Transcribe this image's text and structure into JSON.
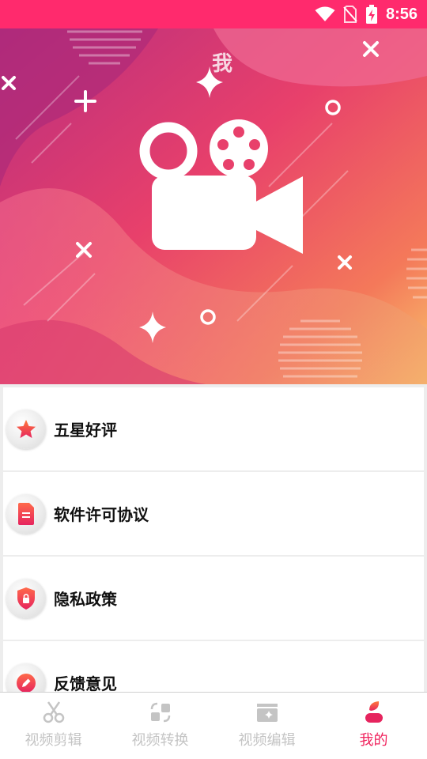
{
  "status": {
    "time": "8:56"
  },
  "banner": {
    "title": "我",
    "gradient": [
      "#b92e7e",
      "#e8406b",
      "#f4795a",
      "#f9c46d"
    ]
  },
  "menu": {
    "items": [
      {
        "label": "五星好评",
        "icon": "star-icon"
      },
      {
        "label": "软件许可协议",
        "icon": "document-icon"
      },
      {
        "label": "隐私政策",
        "icon": "shield-lock-icon"
      },
      {
        "label": "反馈意见",
        "icon": "pencil-icon"
      }
    ]
  },
  "tabs": [
    {
      "label": "视频剪辑",
      "icon": "scissors-icon",
      "active": false
    },
    {
      "label": "视频转换",
      "icon": "convert-icon",
      "active": false
    },
    {
      "label": "视频编辑",
      "icon": "clapperboard-icon",
      "active": false
    },
    {
      "label": "我的",
      "icon": "user-icon",
      "active": true
    }
  ],
  "colors": {
    "status_bar": "#ff2a6d",
    "accent": "#f0245e",
    "inactive_tab": "#c4c4c4"
  }
}
